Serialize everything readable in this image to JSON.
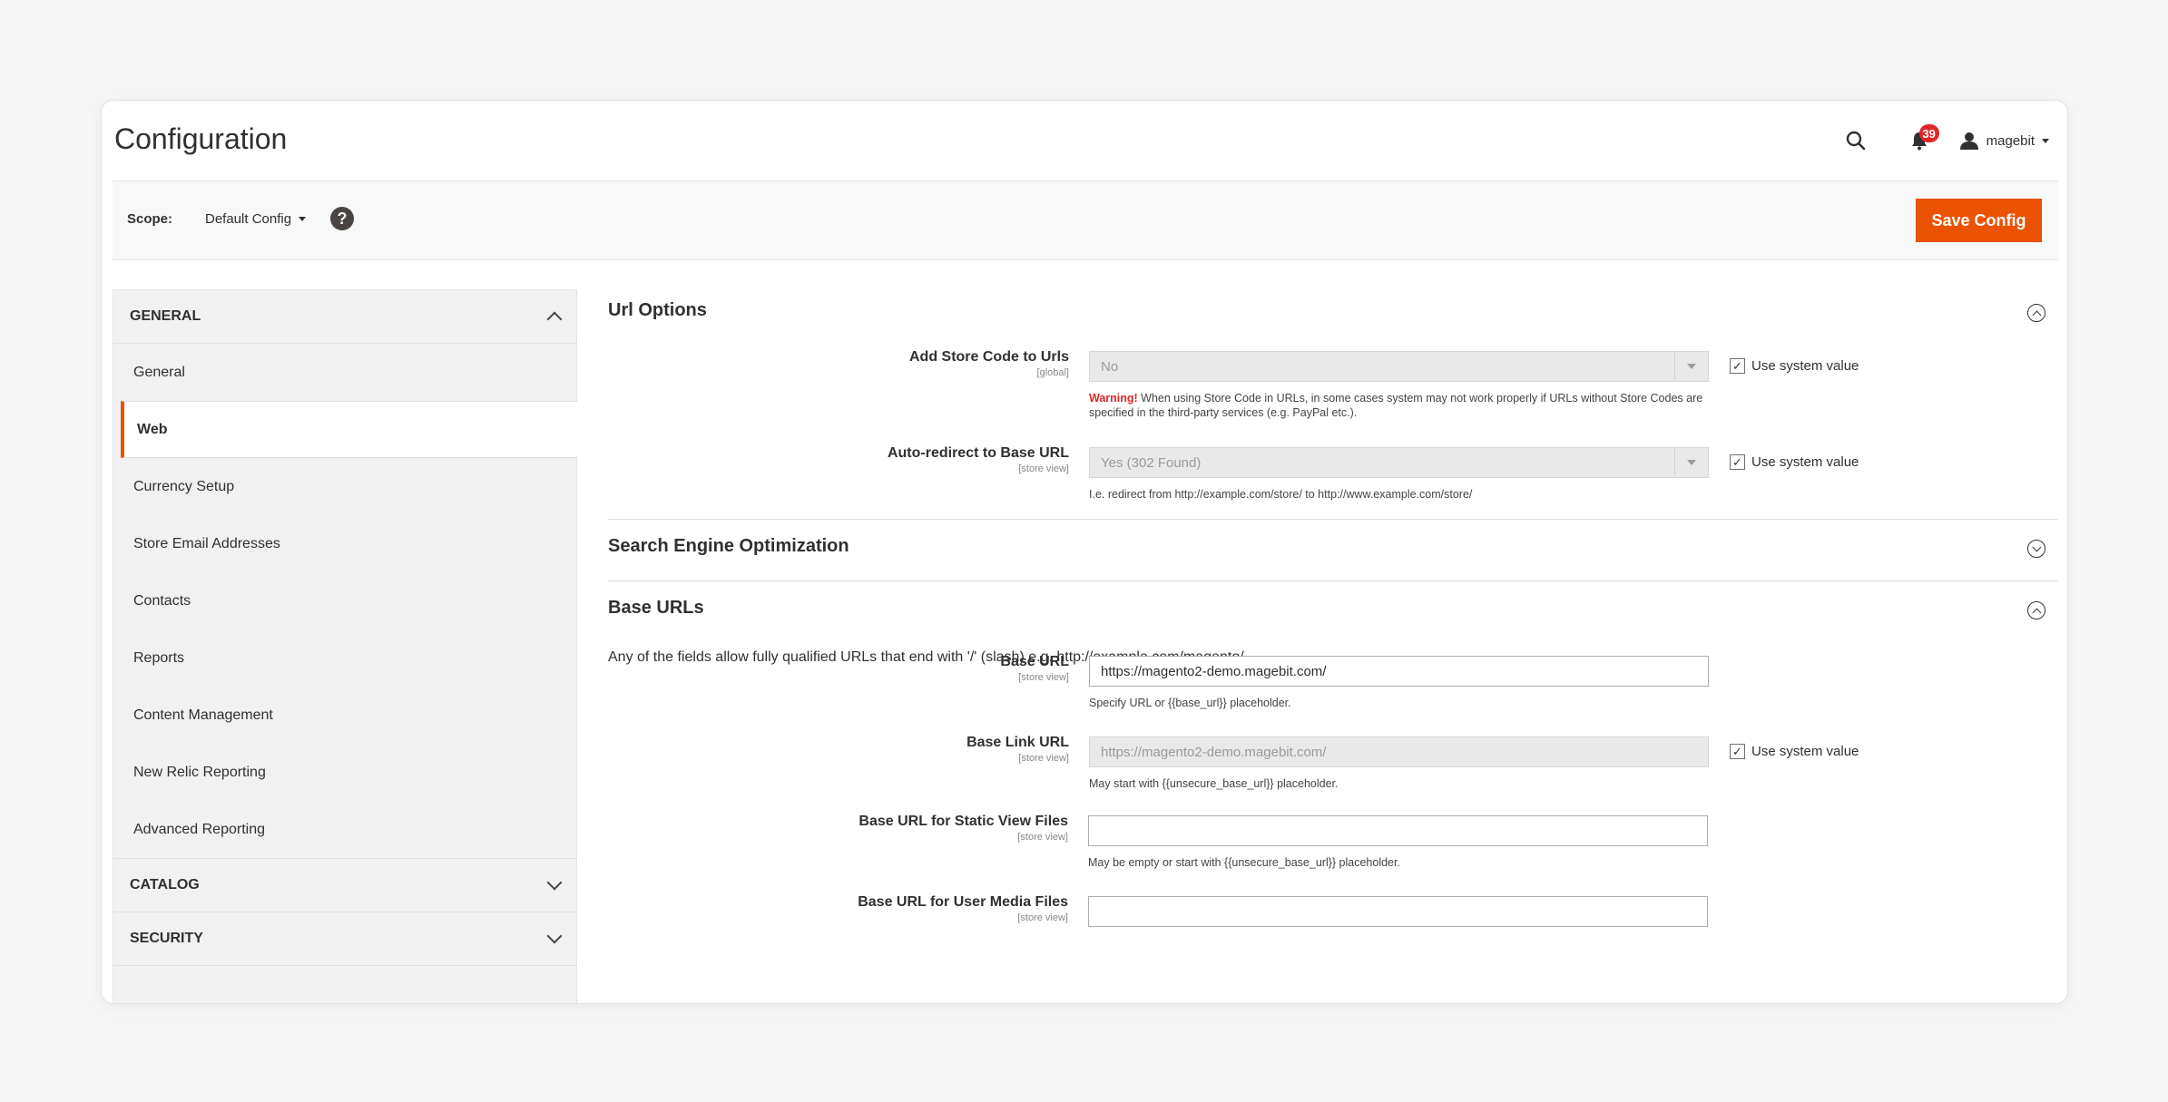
{
  "header": {
    "title": "Configuration",
    "notification_count": "39",
    "username": "magebit"
  },
  "scope_bar": {
    "label": "Scope:",
    "value": "Default Config",
    "help_glyph": "?",
    "save_label": "Save Config"
  },
  "sidebar": {
    "general_title": "GENERAL",
    "items": [
      {
        "label": "General"
      },
      {
        "label": "Web"
      },
      {
        "label": "Currency Setup"
      },
      {
        "label": "Store Email Addresses"
      },
      {
        "label": "Contacts"
      },
      {
        "label": "Reports"
      },
      {
        "label": "Content Management"
      },
      {
        "label": "New Relic Reporting"
      },
      {
        "label": "Advanced Reporting"
      }
    ],
    "catalog_title": "CATALOG",
    "security_title": "SECURITY"
  },
  "url_options": {
    "title": "Url Options",
    "store_code": {
      "label": "Add Store Code to Urls",
      "scope": "[global]",
      "value": "No",
      "use_system": "Use system value",
      "warning_strong": "Warning!",
      "warning_text": " When using Store Code in URLs, in some cases system may not work properly if URLs without Store Codes are specified in the third-party services (e.g. PayPal etc.)."
    },
    "auto_redirect": {
      "label": "Auto-redirect to Base URL",
      "scope": "[store view]",
      "value": "Yes (302 Found)",
      "use_system": "Use system value",
      "note": "I.e. redirect from http://example.com/store/ to http://www.example.com/store/"
    }
  },
  "seo": {
    "title": "Search Engine Optimization"
  },
  "base_urls": {
    "title": "Base URLs",
    "intro": "Any of the fields allow fully qualified URLs that end with '/' (slash) e.g. http://example.com/magento/",
    "base_url": {
      "label": "Base URL",
      "scope": "[store view]",
      "value": "https://magento2-demo.magebit.com/",
      "note": "Specify URL or {{base_url}} placeholder."
    },
    "base_link_url": {
      "label": "Base Link URL",
      "scope": "[store view]",
      "value": "https://magento2-demo.magebit.com/",
      "use_system": "Use system value",
      "note": "May start with {{unsecure_base_url}} placeholder."
    },
    "static_view": {
      "label": "Base URL for Static View Files",
      "scope": "[store view]",
      "value": "",
      "note": "May be empty or start with {{unsecure_base_url}} placeholder."
    },
    "user_media": {
      "label": "Base URL for User Media Files",
      "scope": "[store view]",
      "value": ""
    }
  }
}
